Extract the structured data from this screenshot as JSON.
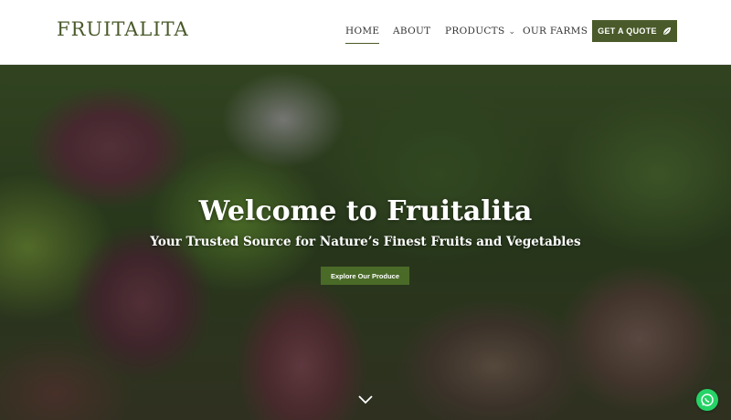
{
  "header": {
    "logo": "FRUITALITA",
    "nav": [
      {
        "label": "HOME",
        "active": true
      },
      {
        "label": "ABOUT"
      },
      {
        "label": "PRODUCTS"
      },
      {
        "label": "OUR FARMS"
      }
    ],
    "quote_button": "GET A QUOTE"
  },
  "hero": {
    "title": "Welcome to Fruitalita",
    "subtitle": "Your Trusted Source for Nature’s Finest Fruits and Vegetables",
    "cta": "Explore Our Produce"
  },
  "icons": {
    "quote": "leaf-icon",
    "products_dropdown": "chevron-down-icon",
    "scroll": "chevron-down-icon",
    "chat": "whatsapp-icon"
  },
  "colors": {
    "brand": "#4a5a2a",
    "cta": "#4a6a28",
    "whatsapp": "#25d366"
  }
}
